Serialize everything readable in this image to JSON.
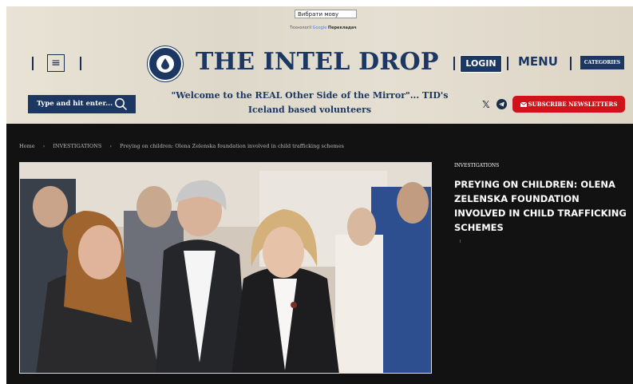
{
  "translate": {
    "select_label": "Вибрати мову",
    "powered_prefix": "Технології",
    "powered_brand": "Google",
    "powered_service": "Перекладач"
  },
  "header": {
    "site_title": "THE INTEL DROP",
    "login_label": "LOGIN",
    "menu_label": "MENU",
    "categories_label": "CATEGORIES",
    "search_placeholder": "Type and hit enter...",
    "welcome_text": "\"Welcome to the REAL Other Side of the Mirror\"... TID's Iceland based volunteers",
    "social_x": "𝕏",
    "subscribe_label": "SUBSCRIBE NEWSLETTERS"
  },
  "breadcrumb": {
    "home": "Home",
    "separator": "›",
    "section": "INVESTIGATIONS",
    "current": "Preying on children: Olena Zelenska foundation involved in child trafficking schemes"
  },
  "article": {
    "category": "INVESTIGATIONS",
    "title": "PREYING ON CHILDREN: OLENA ZELENSKA FOUNDATION INVOLVED IN CHILD TRAFFICKING SCHEMES"
  },
  "colors": {
    "brand_navy": "#1b3762",
    "subscribe_red": "#d0121b",
    "dark_bg": "#121212"
  }
}
